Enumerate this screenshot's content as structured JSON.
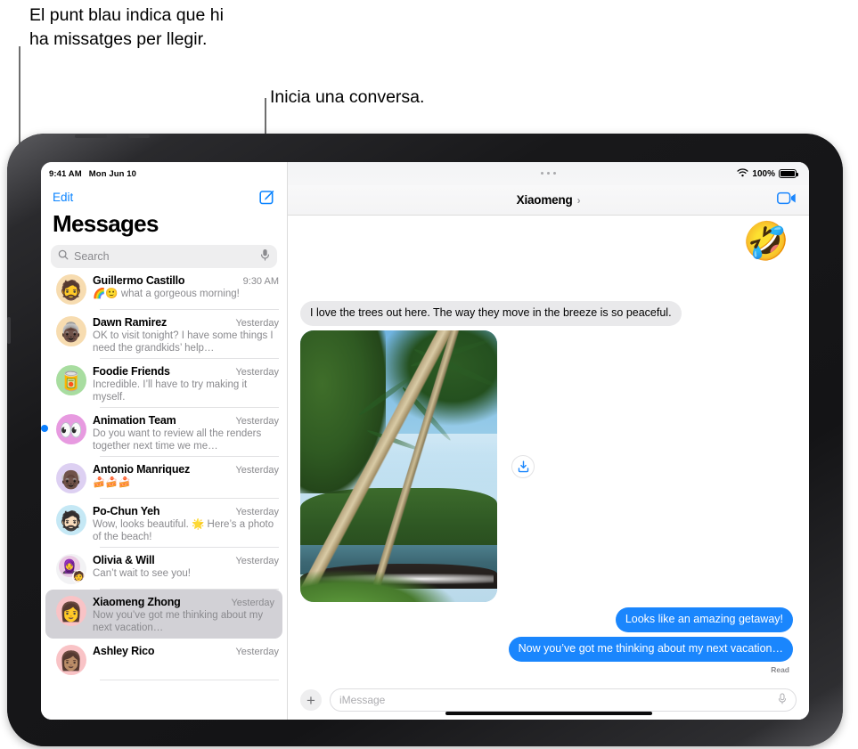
{
  "callouts": [
    {
      "id": "callout-1",
      "text": "El punt blau indica que hi\nha missatges per llegir."
    },
    {
      "id": "callout-2",
      "text": "Inicia una conversa."
    }
  ],
  "sidebar": {
    "status": {
      "time": "9:41 AM",
      "date": "Mon Jun 10"
    },
    "edit_label": "Edit",
    "compose_icon": "compose-icon",
    "title": "Messages",
    "search": {
      "placeholder": "Search",
      "icon": "search-icon",
      "mic_icon": "microphone-icon"
    },
    "conversations": [
      {
        "name": "Guillermo Castillo",
        "time": "9:30 AM",
        "preview": "🌈🙂 what a gorgeous morning!",
        "avatar_glyph": "🧔",
        "avatar_color": "#f7dcb0",
        "unread": false,
        "selected": false
      },
      {
        "name": "Dawn Ramirez",
        "time": "Yesterday",
        "preview": "OK to visit tonight? I have some things I need the grandkids’ help…",
        "avatar_glyph": "👵🏿",
        "avatar_color": "#f7dcb0",
        "unread": false,
        "selected": false
      },
      {
        "name": "Foodie Friends",
        "time": "Yesterday",
        "preview": "Incredible. I’ll have to try making it myself.",
        "avatar_glyph": "🥫",
        "avatar_color": "#a8dda0",
        "unread": false,
        "selected": false
      },
      {
        "name": "Animation Team",
        "time": "Yesterday",
        "preview": "Do you want to review all the renders together next time we me…",
        "avatar_glyph": "👀",
        "avatar_color": "#e79ae0",
        "unread": true,
        "selected": false
      },
      {
        "name": "Antonio Manriquez",
        "time": "Yesterday",
        "preview": "🍰🍰🍰",
        "avatar_glyph": "👴🏿",
        "avatar_color": "#ddd0f2",
        "unread": false,
        "selected": false
      },
      {
        "name": "Po-Chun Yeh",
        "time": "Yesterday",
        "preview": "Wow, looks beautiful. 🌟 Here’s a photo of the beach!",
        "avatar_glyph": "🧔🏻",
        "avatar_color": "#c5e8f5",
        "unread": false,
        "selected": false
      },
      {
        "name": "Olivia & Will",
        "time": "Yesterday",
        "preview": "Can’t wait to see you!",
        "avatar_glyph": "group",
        "avatar_color": "#f2f2f4",
        "unread": false,
        "selected": false
      },
      {
        "name": "Xiaomeng Zhong",
        "time": "Yesterday",
        "preview": "Now you’ve got me thinking about my next vacation…",
        "avatar_glyph": "👩",
        "avatar_color": "#f9c3c6",
        "unread": false,
        "selected": true
      },
      {
        "name": "Ashley Rico",
        "time": "Yesterday",
        "preview": "",
        "avatar_glyph": "👩🏽",
        "avatar_color": "#f9c3c6",
        "unread": false,
        "selected": false
      }
    ]
  },
  "pane": {
    "status": {
      "battery_percent": "100%",
      "wifi_icon": "wifi-icon",
      "battery_icon": "battery-icon"
    },
    "title": "Xiaomeng",
    "chevron": "›",
    "facetime_icon": "facetime-video-icon",
    "reaction_emoji": "🤣",
    "messages": [
      {
        "dir": "in",
        "text": "I love the trees out here. The way they move in the breeze is so peaceful."
      },
      {
        "dir": "photo",
        "text": "beach-photo-attachment",
        "save_icon": "save-to-photos-icon"
      },
      {
        "dir": "out",
        "text": "Looks like an amazing getaway!"
      },
      {
        "dir": "out",
        "text": "Now you’ve got me thinking about my next vacation…"
      }
    ],
    "read_receipt": "Read",
    "composer": {
      "plus_label": "+",
      "placeholder": "iMessage",
      "mic_icon": "microphone-icon"
    }
  },
  "colors": {
    "accent_blue": "#0b84ff",
    "bubble_out": "#1a86fd",
    "bubble_in": "#e9e9eb",
    "unread_dot": "#0b7fff",
    "selected_row": "#d2d1d6"
  }
}
